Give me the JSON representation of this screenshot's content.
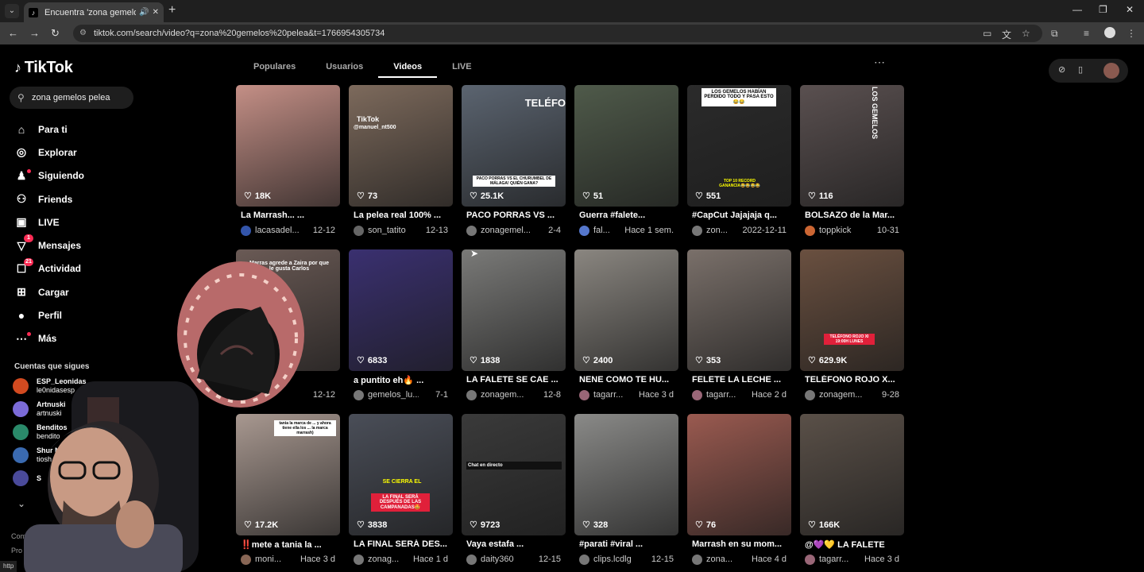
{
  "browser": {
    "tab_title": "Encuentra 'zona gemelos pe",
    "url": "tiktok.com/search/video?q=zona%20gemelos%20pelea&t=1766954305734",
    "new_tab": "+",
    "minimize": "—",
    "restore": "❐",
    "close": "✕"
  },
  "app": {
    "logo": "TikTok",
    "search_value": "zona gemelos pelea"
  },
  "sidebar": {
    "items": [
      {
        "label": "Para ti",
        "icon": "home-icon"
      },
      {
        "label": "Explorar",
        "icon": "compass-icon"
      },
      {
        "label": "Siguiendo",
        "icon": "following-icon"
      },
      {
        "label": "Friends",
        "icon": "friends-icon"
      },
      {
        "label": "LIVE",
        "icon": "live-icon"
      },
      {
        "label": "Mensajes",
        "icon": "messages-icon",
        "badge": "1"
      },
      {
        "label": "Actividad",
        "icon": "activity-icon",
        "badge": "21"
      },
      {
        "label": "Cargar",
        "icon": "upload-icon"
      },
      {
        "label": "Perfil",
        "icon": "profile-icon"
      },
      {
        "label": "Más",
        "icon": "more-icon"
      }
    ],
    "following_title": "Cuentas que sigues",
    "following": [
      {
        "name": "ESP_Leonidas",
        "handle": "le0nidasesp",
        "color": "#d24a20"
      },
      {
        "name": "Artnuski",
        "handle": "artnuski",
        "color": "#7b6bd8"
      },
      {
        "name": "Benditos",
        "handle": "bendito",
        "color": "#2a8a6a"
      },
      {
        "name": "Shur N",
        "handle": "tiosh",
        "color": "#3a6ab0"
      },
      {
        "name": "S",
        "handle": "",
        "color": "#4a4a9a"
      }
    ],
    "footer_1": "Comp",
    "footer_2": "Pro"
  },
  "search_tabs": [
    {
      "label": "Populares",
      "active": false
    },
    {
      "label": "Usuarios",
      "active": false
    },
    {
      "label": "Videos",
      "active": true
    },
    {
      "label": "LIVE",
      "active": false
    }
  ],
  "videos": [
    {
      "likes": "18K",
      "caption": "La Marrash... ...",
      "user": "lacasadel...",
      "date": "12-12",
      "bg": "#c48f86",
      "av": "#3355aa"
    },
    {
      "likes": "73",
      "caption": "La pelea real 100% ...",
      "user": "son_tatito",
      "date": "12-13",
      "bg": "#7d6a5c",
      "av": "#666"
    },
    {
      "likes": "25.1K",
      "caption": "PACO PORRAS VS ...",
      "user": "zonagemel...",
      "date": "2-4",
      "bg": "#5b6470",
      "av": "#777"
    },
    {
      "likes": "51",
      "caption": "Guerra #falete...",
      "user": "fal...",
      "date": "Hace 1 sem.",
      "bg": "#4f5a4a",
      "av": "#5577cc"
    },
    {
      "likes": "551",
      "caption": "#CapCut Jajajaja q...",
      "user": "zon...",
      "date": "2022-12-11",
      "bg": "#2b2b2b",
      "av": "#777"
    },
    {
      "likes": "116",
      "caption": "BOLSAZO de la Mar...",
      "user": "toppkick",
      "date": "10-31",
      "bg": "#5a5050",
      "av": "#cc6633"
    },
    {
      "likes": "",
      "caption": "...jaj ...",
      "user": "",
      "date": "12-12",
      "bg": "#6a5a55",
      "av": "#555"
    },
    {
      "likes": "6833",
      "caption": "a puntito eh🔥 ...",
      "user": "gemelos_lu...",
      "date": "7-1",
      "bg": "#3a3070",
      "av": "#777"
    },
    {
      "likes": "1838",
      "caption": "LA FALETE SE CAE ...",
      "user": "zonagem...",
      "date": "12-8",
      "bg": "#7a7a78",
      "av": "#777"
    },
    {
      "likes": "2400",
      "caption": "NENE COMO TE HU...",
      "user": "tagarr...",
      "date": "Hace 3 d",
      "bg": "#8a8680",
      "av": "#996677"
    },
    {
      "likes": "353",
      "caption": "FELETE LA LECHE ...",
      "user": "tagarr...",
      "date": "Hace 2 d",
      "bg": "#7a706a",
      "av": "#996677"
    },
    {
      "likes": "629.9K",
      "caption": "TELÉFONO ROJO X...",
      "user": "zonagem...",
      "date": "9-28",
      "bg": "#6a5040",
      "av": "#777"
    },
    {
      "likes": "17.2K",
      "caption": "‼️mete a tania la ...",
      "user": "moni...",
      "date": "Hace 3 d",
      "bg": "#a89890",
      "av": "#886655"
    },
    {
      "likes": "3838",
      "caption": "LA FINAL SERÁ DES...",
      "user": "zonag...",
      "date": "Hace 1 d",
      "bg": "#4a4e58",
      "av": "#777"
    },
    {
      "likes": "9723",
      "caption": "Vaya estafa ...",
      "user": "daity360",
      "date": "12-15",
      "bg": "#3a3a3a",
      "av": "#777"
    },
    {
      "likes": "328",
      "caption": "#parati #viral ...",
      "user": "clips.lcdlg",
      "date": "12-15",
      "bg": "#8a8a88",
      "av": "#777"
    },
    {
      "likes": "76",
      "caption": "Marrash en su mom...",
      "user": "zona...",
      "date": "Hace 4 d",
      "bg": "#9a5a50",
      "av": "#777"
    },
    {
      "likes": "166K",
      "caption": "@💜💛 LA FALETE",
      "user": "tagarr...",
      "date": "Hace 3 d",
      "bg": "#5a5048",
      "av": "#996677"
    }
  ],
  "overlays": {
    "t2": "TikTok",
    "t2b": "@manuel_nt500",
    "t3": "TELÉFO",
    "t3b": "PACO PORRAS VS EL CHURUMBEL DE MÁLAGA! QUIÉN GANA?",
    "t5": "LOS GEMELOS HABÍAN PERDIDO TODO Y PASA ESTO😂😂",
    "t5b": "TOP 10 RECORD GANANCIA😂😂😂😂",
    "t6": "LOS GEMELOS",
    "t7": "Marras agrede a Zaira por que le gusta Carlos",
    "t12": "TELÉFONO ROJO XI 19:00H LUNES",
    "t14a": "SE CIERRA EL",
    "t14b": "LA FINAL SERÁ DESPUÉS DE LAS CAMPANADAS🤩",
    "t15": "Chat en directo",
    "t13": "tania la marca de ... y ahora tiene ella los ... la marca marrash)"
  },
  "status_url": "http"
}
